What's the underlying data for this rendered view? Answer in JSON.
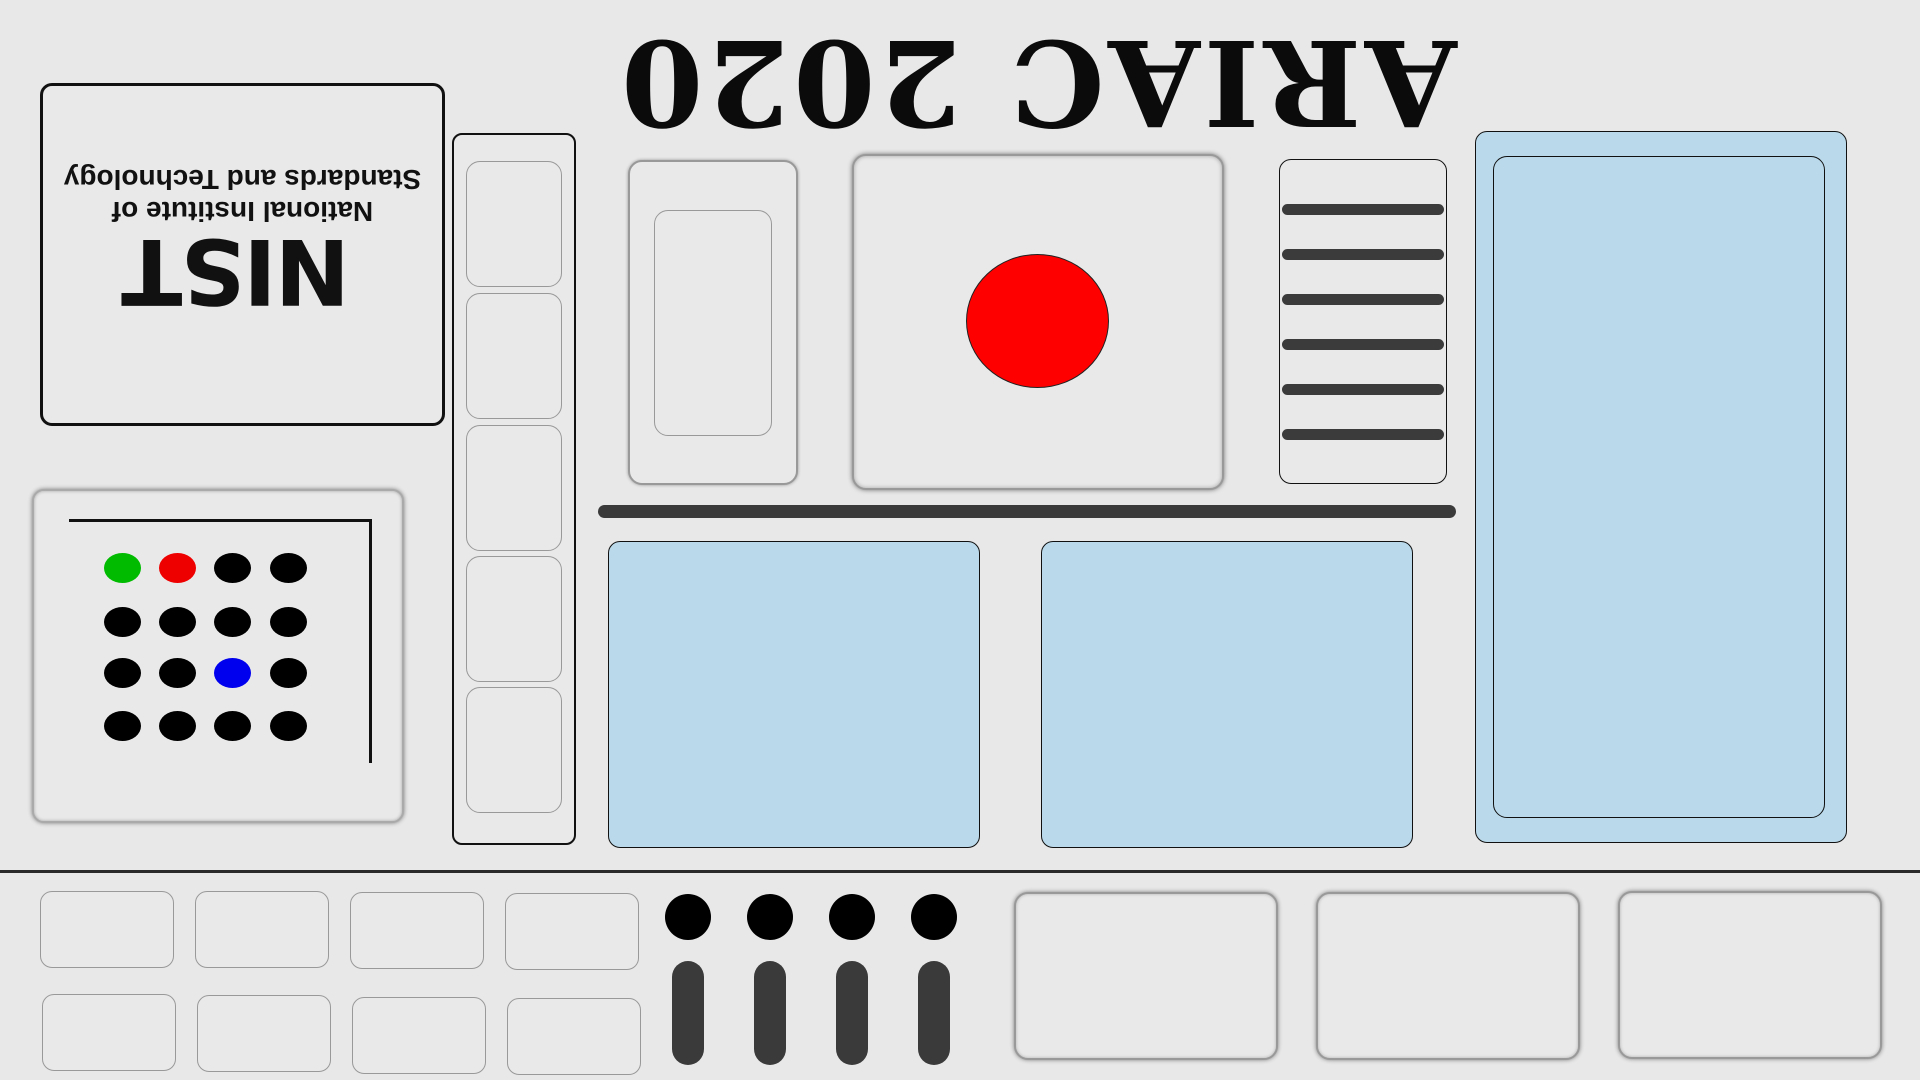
{
  "title": "ARIAC 2020",
  "logo": {
    "wordmark": "NIST",
    "line1": "National Institute of",
    "line2": "Standards and Technology"
  },
  "colors": {
    "background": "#e8e8e8",
    "bin_blue": "#badaeb",
    "red_marker": "#ff0000",
    "dot_green": "#00bb00",
    "dot_red": "#ee0000",
    "dot_blue": "#0000ee",
    "dot_black": "#000000",
    "bar_dark": "#3a3a3a"
  },
  "dot_grid": {
    "rows": [
      [
        "green",
        "red",
        "black",
        "black"
      ],
      [
        "black",
        "black",
        "black",
        "black"
      ],
      [
        "black",
        "black",
        "blue",
        "black"
      ],
      [
        "black",
        "black",
        "black",
        "black"
      ]
    ]
  }
}
